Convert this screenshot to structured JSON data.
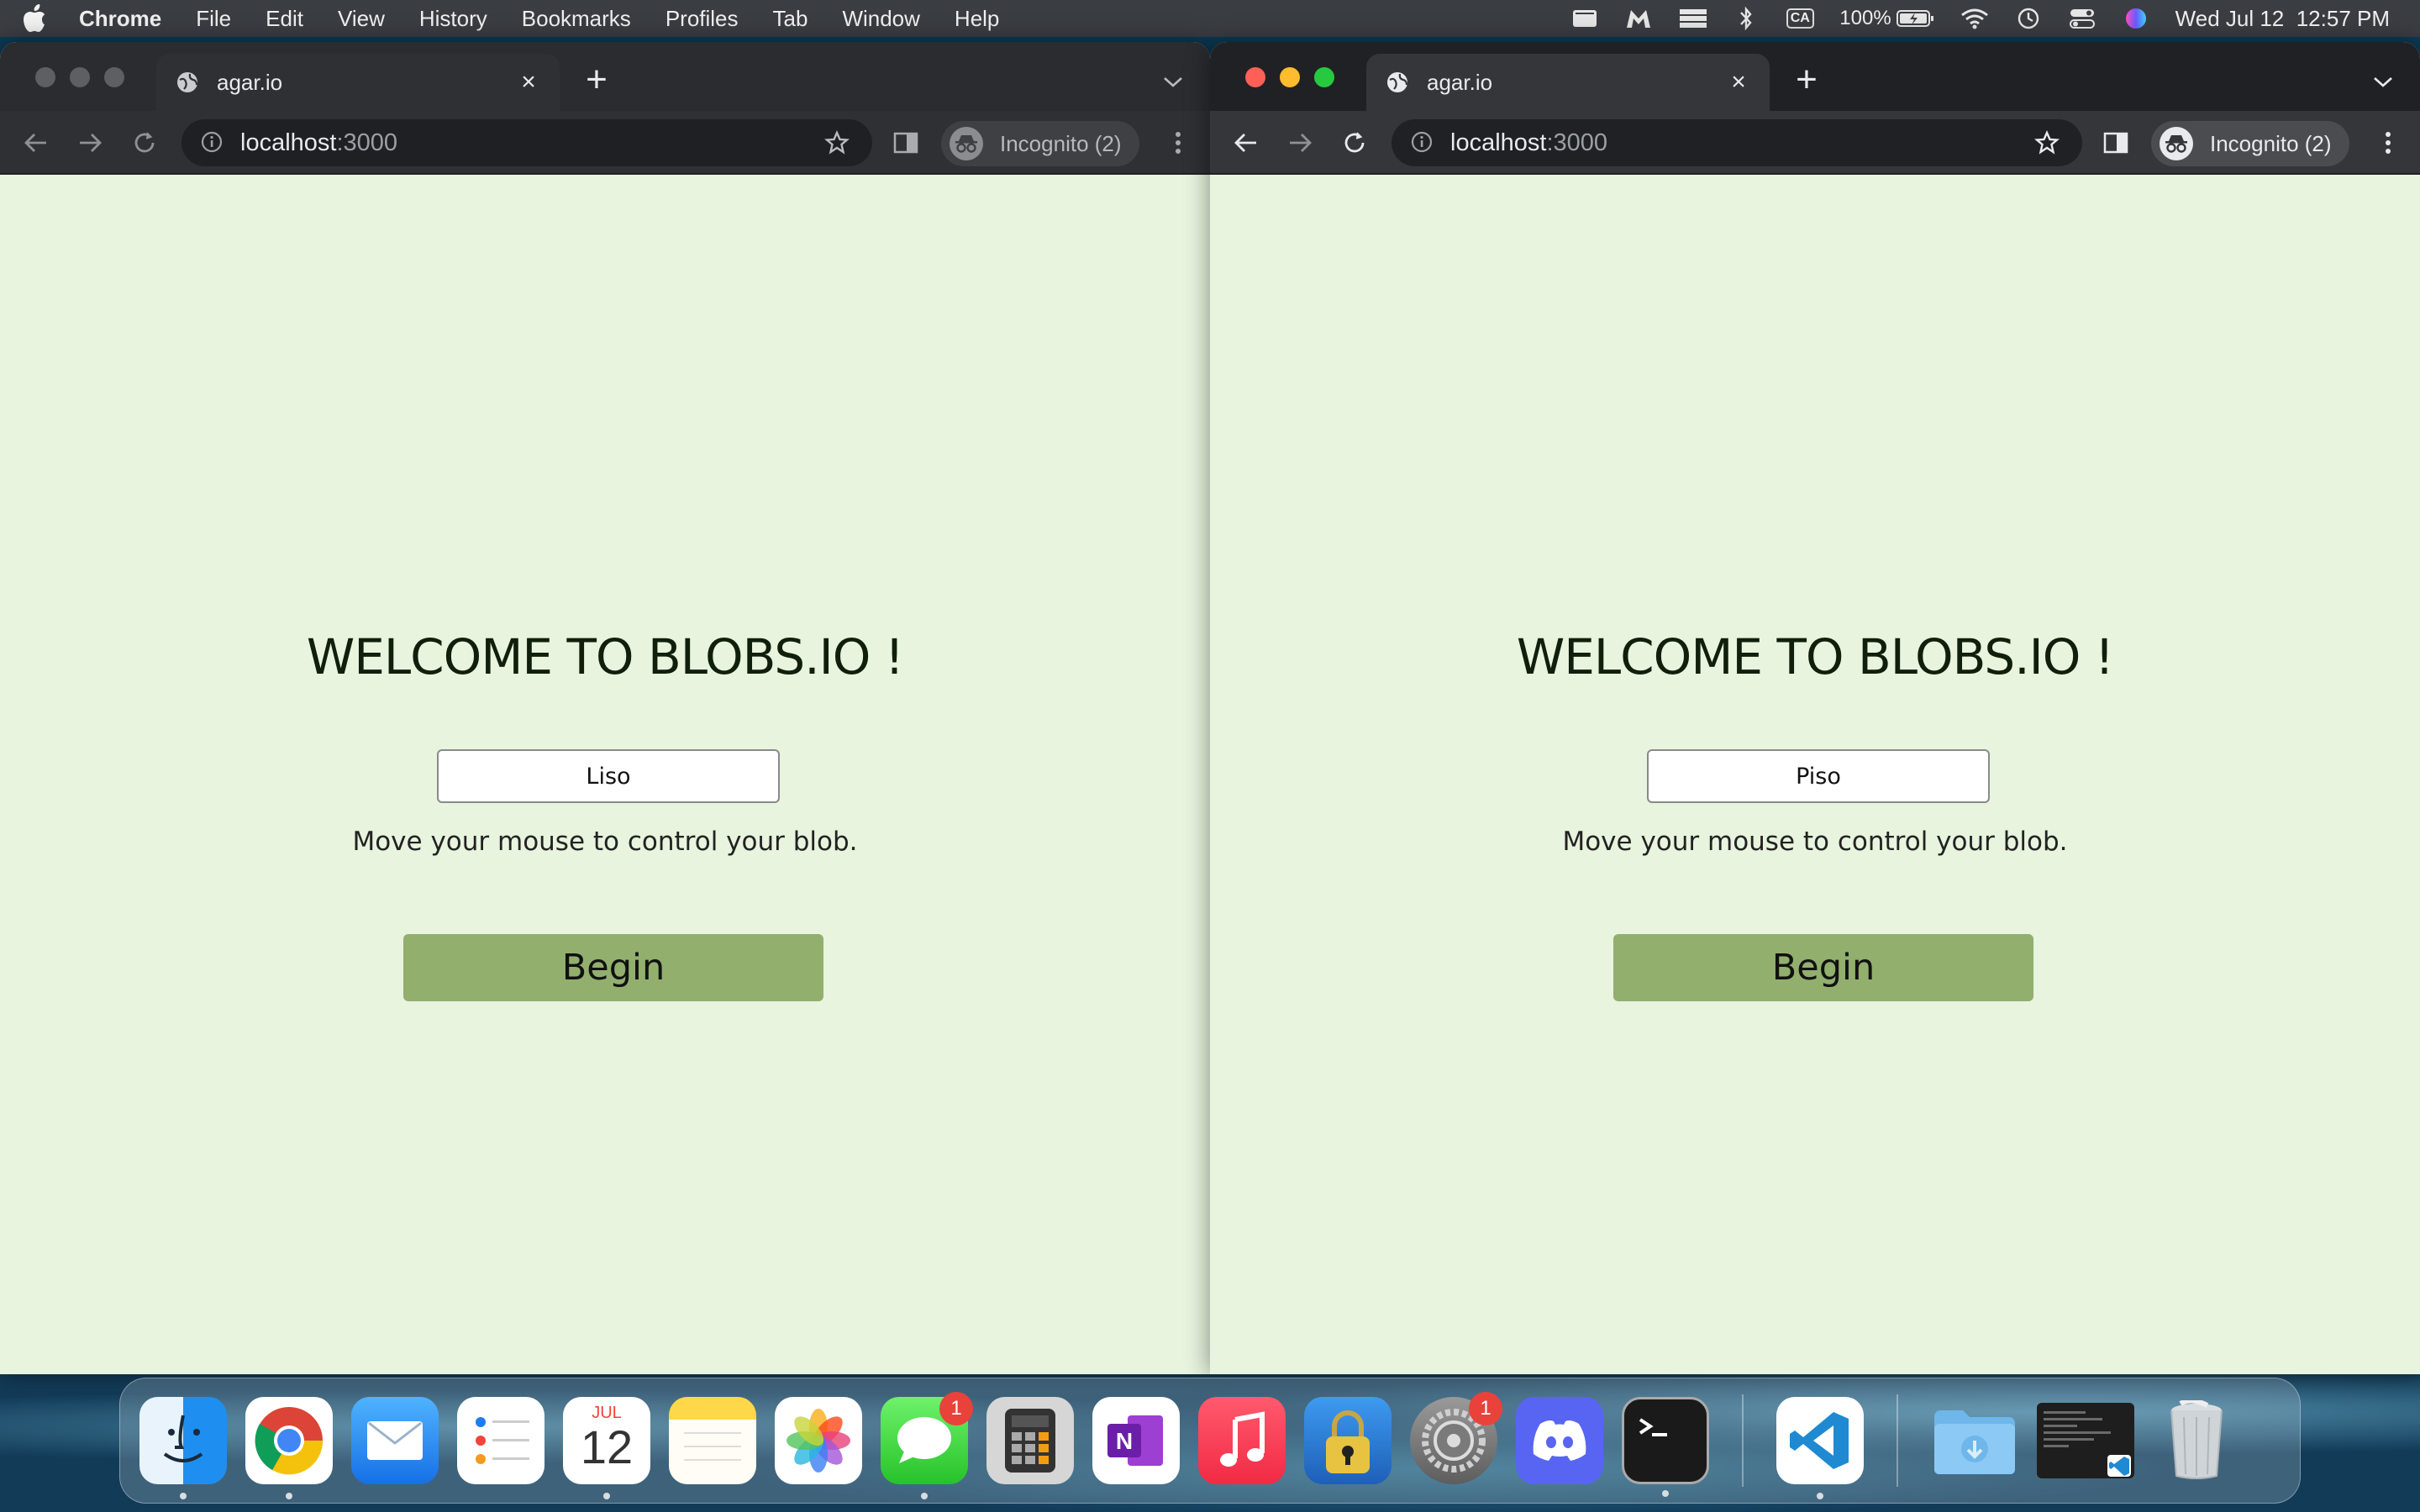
{
  "menubar": {
    "app_name": "Chrome",
    "menus": [
      "File",
      "Edit",
      "View",
      "History",
      "Bookmarks",
      "Profiles",
      "Tab",
      "Window",
      "Help"
    ],
    "status_icons": [
      "app-window-icon",
      "malwarebytes-icon",
      "stack-icon",
      "bluetooth-icon",
      "input-source-icon",
      "battery-icon",
      "wifi-icon",
      "time-machine-icon",
      "control-center-icon",
      "siri-icon"
    ],
    "input_source": "CA",
    "battery": "100%",
    "clock": "Wed Jul 12  12:57 PM"
  },
  "windows": [
    {
      "tab_title": "agar.io",
      "url_host": "localhost",
      "url_port": ":3000",
      "incognito_label": "Incognito (2)",
      "page": {
        "heading": "WELCOME TO BLOBS.IO !",
        "name_value": "Liso",
        "instructions": "Move your mouse to control your blob.",
        "button_label": "Begin"
      }
    },
    {
      "tab_title": "agar.io",
      "url_host": "localhost",
      "url_port": ":3000",
      "incognito_label": "Incognito (2)",
      "page": {
        "heading": "WELCOME TO BLOBS.IO !",
        "name_value": "Piso",
        "instructions": "Move your mouse to control your blob.",
        "button_label": "Begin"
      }
    }
  ],
  "dock": {
    "calendar_month": "JUL",
    "calendar_day": "12",
    "messages_badge": "1",
    "settings_badge": "1",
    "apps": [
      "finder",
      "chrome",
      "mail",
      "reminders",
      "calendar",
      "notes",
      "photos",
      "messages",
      "calculator",
      "onenote",
      "music",
      "keychain",
      "system-settings",
      "discord",
      "terminal",
      "vscode",
      "downloads",
      "recent-window",
      "trash"
    ]
  },
  "colors": {
    "page_bg": "#e8f4de",
    "button_bg": "#92af6e",
    "heading": "#101f0b"
  }
}
